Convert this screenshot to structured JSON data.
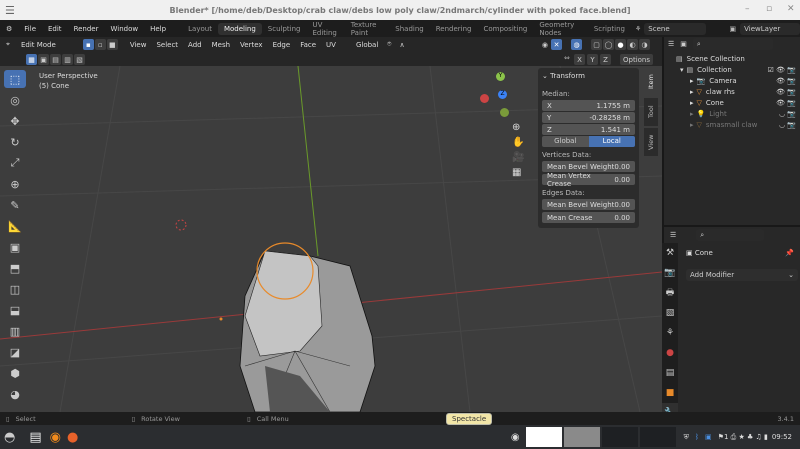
{
  "window": {
    "title": "Blender* [/home/deb/Desktop/crab claw/debs low poly claw/2ndmarch/cylinder with poked face.blend]"
  },
  "menu": [
    "File",
    "Edit",
    "Render",
    "Window",
    "Help"
  ],
  "workspaces": [
    "Layout",
    "Modeling",
    "Sculpting",
    "UV Editing",
    "Texture Paint",
    "Shading",
    "Rendering",
    "Compositing",
    "Geometry Nodes",
    "Scripting"
  ],
  "active_workspace": "Modeling",
  "scene": "Scene",
  "view_layer": "ViewLayer",
  "header": {
    "mode": "Edit Mode",
    "menus": [
      "View",
      "Select",
      "Add",
      "Mesh",
      "Vertex",
      "Edge",
      "Face",
      "UV"
    ],
    "orientation": "Global",
    "options": "Options",
    "axes": [
      "X",
      "Y",
      "Z"
    ]
  },
  "viewport": {
    "perspective": "User Perspective",
    "object": "(5) Cone"
  },
  "npanel": {
    "title": "Transform",
    "median": "Median:",
    "x_label": "X",
    "x": "1.1755 m",
    "y_label": "Y",
    "y": "-0.28258 m",
    "z_label": "Z",
    "z": "1.541 m",
    "global": "Global",
    "local": "Local",
    "vertices_data": "Vertices Data:",
    "mean_bevel_weight": "Mean Bevel Weight",
    "mbw_v": "0.00",
    "mean_vertex_crease": "Mean Vertex Crease",
    "mvc_v": "0.00",
    "edges_data": "Edges Data:",
    "mean_bevel_weight_e": "Mean Bevel Weight",
    "mbw_e": "0.00",
    "mean_crease": "Mean Crease",
    "mc_v": "0.00",
    "tabs": [
      "Item",
      "Tool",
      "View"
    ]
  },
  "outliner": {
    "scene_collection": "Scene Collection",
    "collection": "Collection",
    "items": [
      "Camera",
      "claw rhs",
      "Cone",
      "Light",
      "smasmall claw"
    ]
  },
  "properties": {
    "object": "Cone",
    "add_modifier": "Add Modifier"
  },
  "status": {
    "select": "Select",
    "rotate": "Rotate View",
    "menu": "Call Menu",
    "version": "3.4.1"
  },
  "taskbar": {
    "tooltip": "Spectacle",
    "time": "09:52"
  }
}
